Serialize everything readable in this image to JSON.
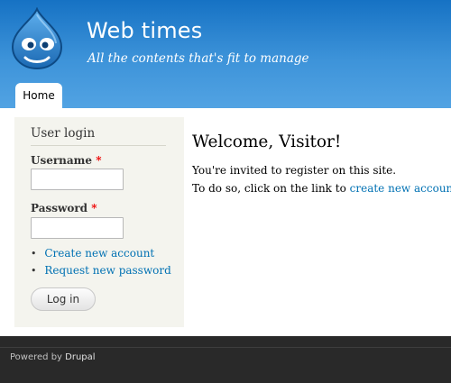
{
  "header": {
    "site_name": "Web times",
    "site_slogan": "All the contents that's fit to manage",
    "logo_icon": "drupal-drop-logo"
  },
  "nav": {
    "tabs": [
      {
        "label": "Home",
        "active": true
      }
    ]
  },
  "sidebar": {
    "block_title": "User login",
    "username_label": "Username",
    "password_label": "Password",
    "required_mark": "*",
    "username_value": "",
    "password_value": "",
    "links": [
      {
        "label": "Create new account"
      },
      {
        "label": "Request new password"
      }
    ],
    "login_button": "Log in"
  },
  "main": {
    "title": "Welcome, Visitor!",
    "line1": "You're invited to register on this site.",
    "line2_prefix": "To do so, click on the link to ",
    "line2_link": "create new account",
    "line2_suffix": "."
  },
  "footer": {
    "prefix": "Powered by ",
    "link": "Drupal"
  },
  "colors": {
    "header_top": "#1672c4",
    "header_bottom": "#52a3e3",
    "link": "#0071b3",
    "required": "#e00000",
    "footer_bg": "#292929"
  }
}
